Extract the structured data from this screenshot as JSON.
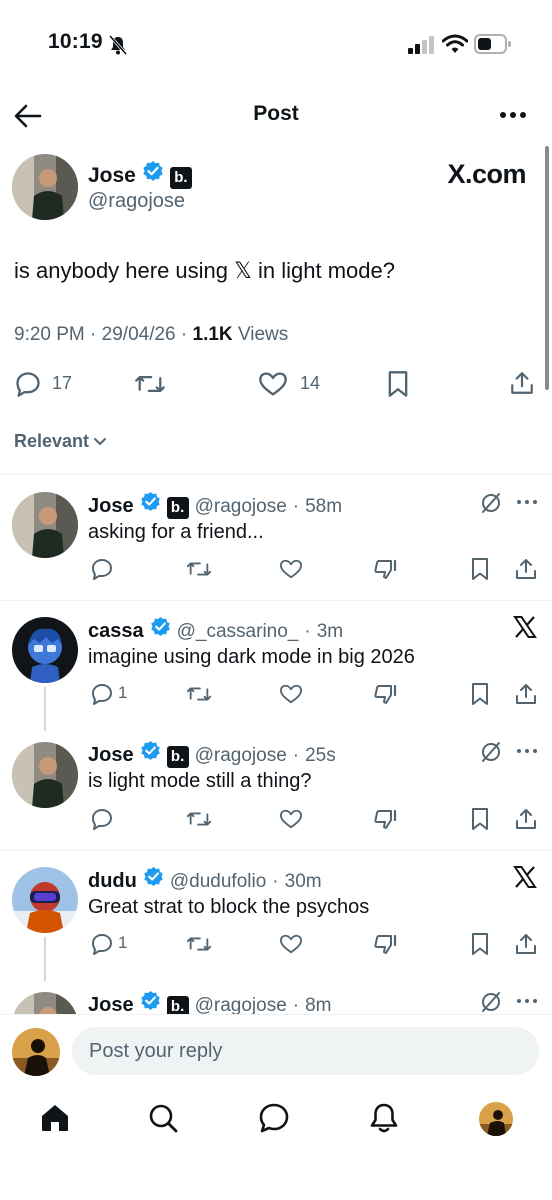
{
  "status_bar": {
    "time": "10:19"
  },
  "header": {
    "title": "Post"
  },
  "post": {
    "author_name": "Jose",
    "badge": "b.",
    "handle": "@ragojose",
    "brand_text": "X.com",
    "text_before": "is anybody here using ",
    "text_x_glyph": "𝕏",
    "text_after": " in light mode?",
    "time": "9:20 PM",
    "date": "29/04/26",
    "views_count": "1.1K",
    "views_label": "Views",
    "reply_count": "17",
    "like_count": "14"
  },
  "filter": {
    "label": "Relevant"
  },
  "replies": [
    {
      "name": "Jose",
      "badge": "b.",
      "handle": "@ragojose",
      "time": "58m",
      "text": "asking for a friend...",
      "reply_count": ""
    },
    {
      "name": "cassa",
      "handle": "@_cassarino_",
      "time": "3m",
      "text": "imagine using dark mode in big 2026",
      "reply_count": "1"
    },
    {
      "name": "Jose",
      "badge": "b.",
      "handle": "@ragojose",
      "time": "25s",
      "text": "is light mode still a thing?",
      "reply_count": ""
    },
    {
      "name": "dudu",
      "handle": "@dudufolio",
      "time": "30m",
      "text": "Great strat to block the psychos",
      "reply_count": "1"
    },
    {
      "name": "Jose",
      "badge": "b.",
      "handle": "@ragojose",
      "time": "8m",
      "text": ""
    }
  ],
  "composer": {
    "placeholder": "Post your reply"
  },
  "colors": {
    "accent": "#1d9bf0",
    "text": "#0f1419",
    "secondary": "#536471",
    "divider": "#eff3f4"
  },
  "icons": [
    "back-arrow-icon",
    "more-icon",
    "verified-icon",
    "reply-icon",
    "repost-icon",
    "like-icon",
    "dislike-icon",
    "bookmark-icon",
    "share-icon",
    "grok-icon",
    "x-logo-icon",
    "home-icon",
    "search-icon",
    "messages-icon",
    "notifications-icon"
  ]
}
